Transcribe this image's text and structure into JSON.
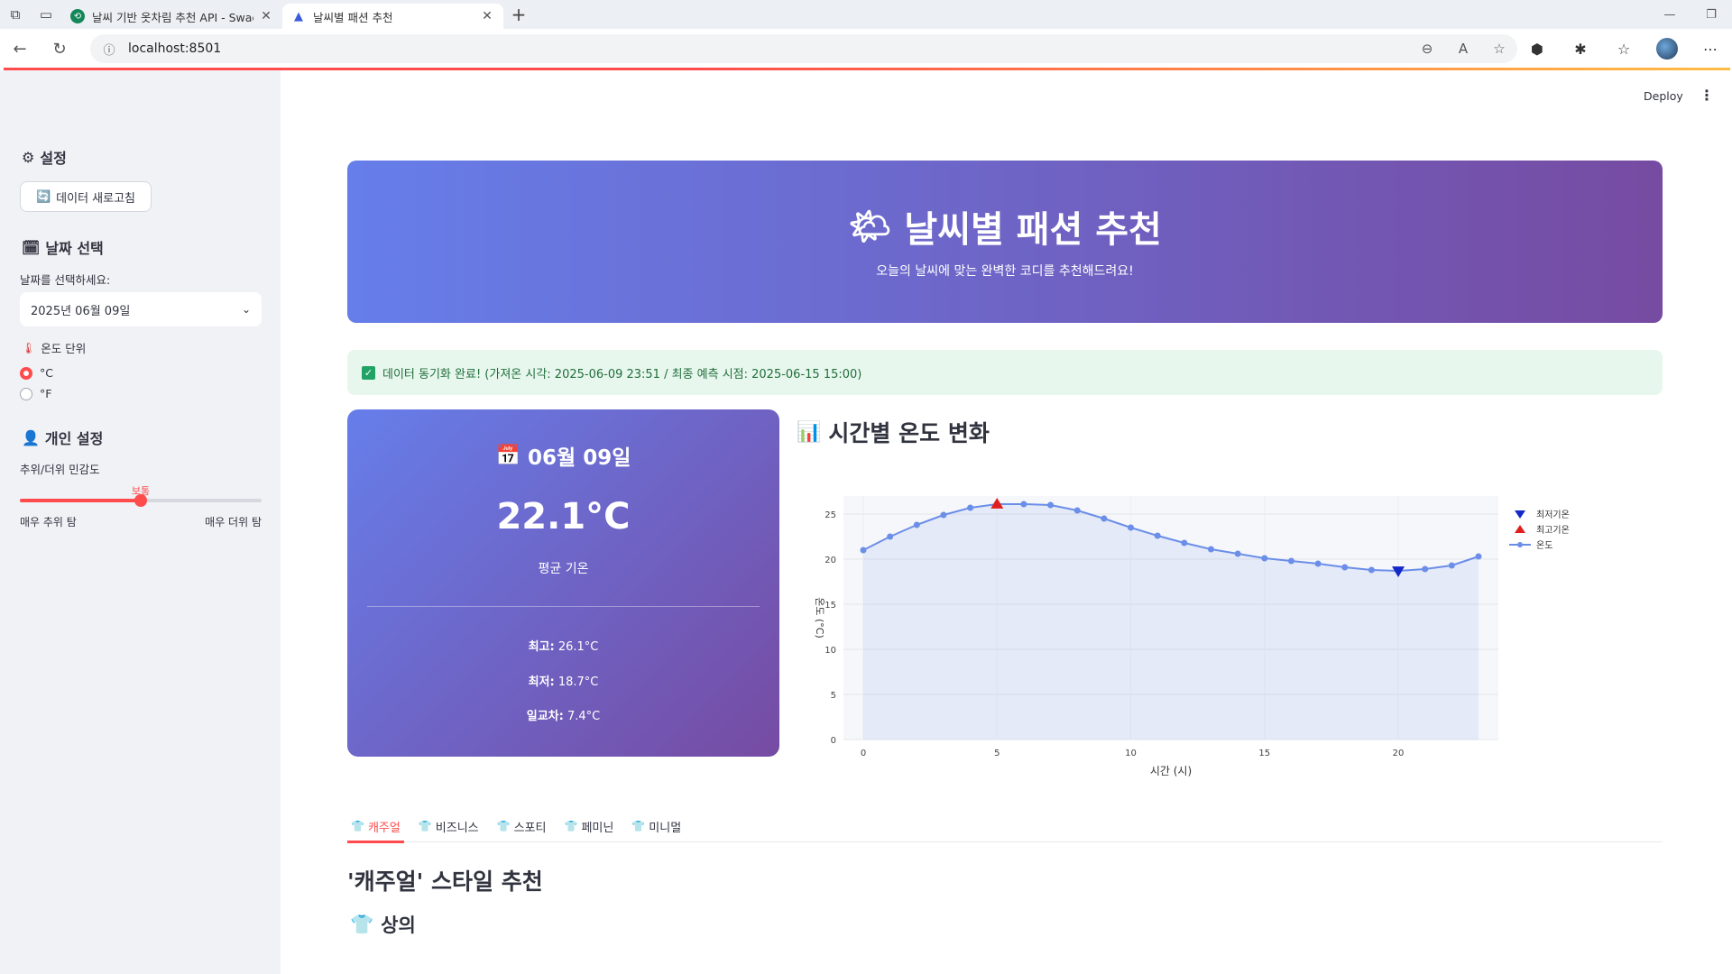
{
  "browser": {
    "tabs": [
      {
        "title": "날씨 기반 옷차림 추천 API - Swag",
        "active": false
      },
      {
        "title": "날씨별 패션 추천",
        "active": true
      }
    ],
    "url": "localhost:8501"
  },
  "app": {
    "deploy_label": "Deploy"
  },
  "sidebar": {
    "settings_title": "설정",
    "refresh_button": "데이터 새로고침",
    "date_section_title": "날짜 선택",
    "date_prompt": "날짜를 선택하세요:",
    "selected_date": "2025년 06월 09일",
    "temp_unit_title": "온도 단위",
    "temp_units": [
      "°C",
      "°F"
    ],
    "temp_unit_selected": "°C",
    "personal_title": "개인 설정",
    "sensitivity_label": "추위/더위 민감도",
    "sensitivity_value": "보통",
    "sensitivity_fraction": 0.5,
    "sensitivity_min": "매우 추위 탐",
    "sensitivity_max": "매우 더위 탐"
  },
  "hero": {
    "title": "날씨별 패션 추천",
    "subtitle": "오늘의 날씨에 맞는 완벽한 코디를 추천해드려요!"
  },
  "status": {
    "message": "데이터 동기화 완료! (가져온 시각: 2025-06-09 23:51 / 최종 예측 시점: 2025-06-15 15:00)"
  },
  "weather_card": {
    "date": "06월 09일",
    "temperature": "22.1°C",
    "avg_label": "평균 기온",
    "max_label": "최고:",
    "max_value": "26.1°C",
    "min_label": "최저:",
    "min_value": "18.7°C",
    "range_label": "일교차:",
    "range_value": "7.4°C"
  },
  "chart_section": {
    "title": "시간별 온도 변화"
  },
  "chart_data": {
    "type": "line",
    "xlabel": "시간 (시)",
    "ylabel": "온도 (°C)",
    "xlim": [
      0,
      23
    ],
    "ylim": [
      0,
      27
    ],
    "x_ticks": [
      0,
      5,
      10,
      15,
      20
    ],
    "y_ticks": [
      0,
      5,
      10,
      15,
      20,
      25
    ],
    "grid": true,
    "fill": "tozero",
    "legend_position": "top-right",
    "series": [
      {
        "name": "온도",
        "color": "#6b8ee8",
        "x": [
          0,
          1,
          2,
          3,
          4,
          5,
          6,
          7,
          8,
          9,
          10,
          11,
          12,
          13,
          14,
          15,
          16,
          17,
          18,
          19,
          20,
          21,
          22,
          23
        ],
        "values": [
          21.0,
          22.5,
          23.8,
          24.9,
          25.7,
          26.1,
          26.1,
          26.0,
          25.4,
          24.5,
          23.5,
          22.6,
          21.8,
          21.1,
          20.6,
          20.1,
          19.8,
          19.5,
          19.1,
          18.8,
          18.7,
          18.9,
          19.3,
          20.3
        ]
      },
      {
        "name": "최고기온",
        "color": "#e01e1e",
        "marker": "triangle-up",
        "x": [
          5
        ],
        "values": [
          26.1
        ]
      },
      {
        "name": "최저기온",
        "color": "#1428c8",
        "marker": "triangle-down",
        "x": [
          20
        ],
        "values": [
          18.7
        ]
      }
    ],
    "legend": [
      "최저기온",
      "최고기온",
      "온도"
    ]
  },
  "style_tabs": [
    "캐주얼",
    "비즈니스",
    "스포티",
    "페미닌",
    "미니멀"
  ],
  "active_style_tab": 0,
  "recommendation": {
    "title": "'캐주얼' 스타일 추천",
    "subsection": "상의"
  }
}
